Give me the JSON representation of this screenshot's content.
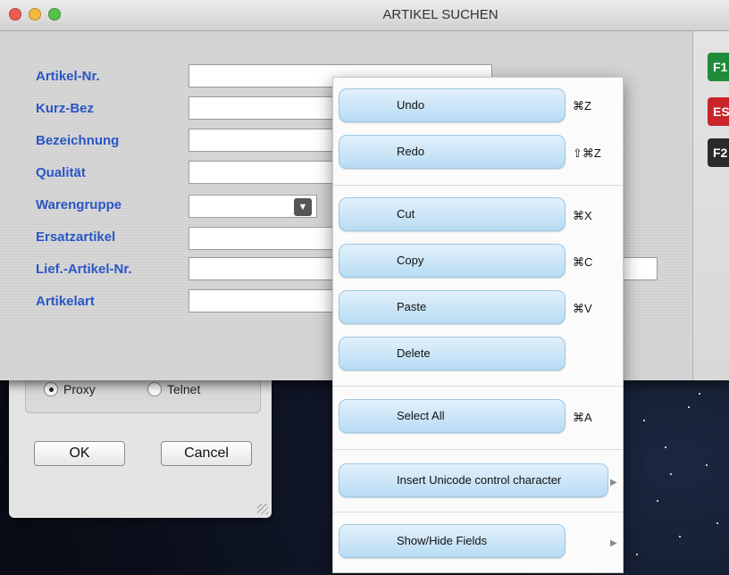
{
  "window": {
    "title": "ARTIKEL SUCHEN"
  },
  "form": {
    "labels": [
      "Artikel-Nr.",
      "Kurz-Bez",
      "Bezeichnung",
      "Qualität",
      "Warengruppe",
      "Ersatzartikel",
      "Lief.-Artikel-Nr.",
      "Artikelart"
    ]
  },
  "side_keys": [
    {
      "label": "F1",
      "color": "#1f8a3a"
    },
    {
      "label": "ES",
      "color": "#c9252b"
    },
    {
      "label": "F2",
      "color": "#2a2a2a"
    }
  ],
  "background_dialog": {
    "radio_proxy": "Proxy",
    "radio_telnet": "Telnet",
    "ok": "OK",
    "cancel": "Cancel"
  },
  "context_menu": {
    "items": [
      {
        "label": "Undo",
        "shortcut": "⌘Z"
      },
      {
        "label": "Redo",
        "shortcut": "⇧⌘Z"
      },
      {
        "label": "Cut",
        "shortcut": "⌘X"
      },
      {
        "label": "Copy",
        "shortcut": "⌘C"
      },
      {
        "label": "Paste",
        "shortcut": "⌘V"
      },
      {
        "label": "Delete",
        "shortcut": ""
      },
      {
        "label": "Select All",
        "shortcut": "⌘A"
      },
      {
        "label": "Insert Unicode control character",
        "shortcut": ""
      },
      {
        "label": "Show/Hide Fields",
        "shortcut": ""
      }
    ],
    "submenu_arrow": "▶"
  },
  "icons": {
    "select_arrow": "▼",
    "close": "close-icon",
    "minimize": "minimize-icon",
    "zoom": "zoom-icon"
  },
  "colors": {
    "label_blue": "#2a56c6",
    "menu_item_blue": "#b8dcf4"
  }
}
